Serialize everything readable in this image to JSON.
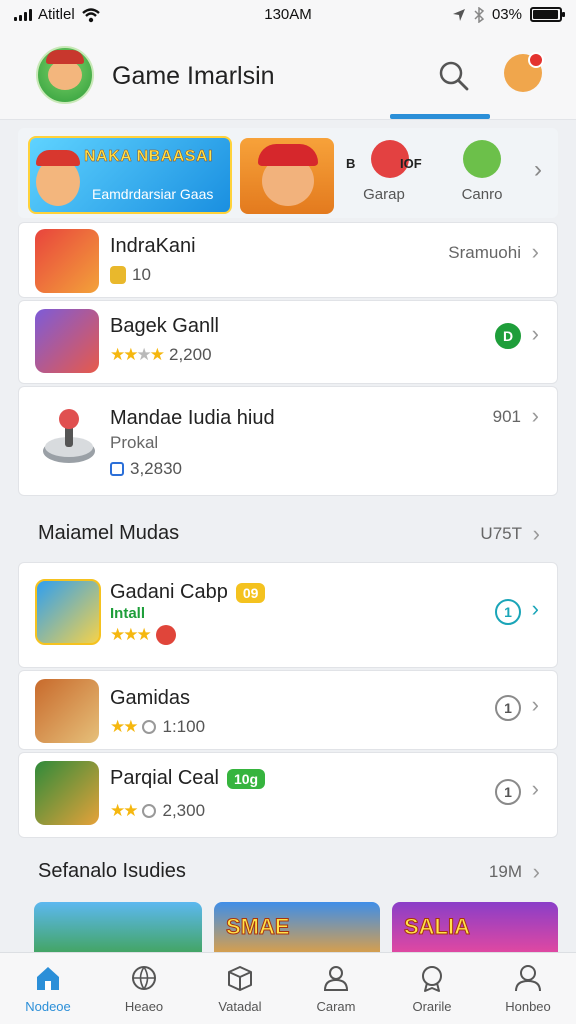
{
  "status_bar": {
    "carrier": "Atitlel",
    "time": "130AM",
    "battery": "03%",
    "battery_level": 0.95
  },
  "header": {
    "app_title": "Game Imarlsin",
    "search_icon": "search-icon",
    "profile_icon": "avatar"
  },
  "carousel": {
    "banner_title": "NAKA NBAASAI",
    "banner_subtitle": "Eamdrdarsiar Gaas",
    "item1_top": "B",
    "item1_top_text": "IOF",
    "item1_label": "Garap",
    "item2_label": "Canro"
  },
  "list": [
    {
      "name": "IndraKani",
      "meta": "10",
      "right": "Sramuohi",
      "accent": "#e9b82c"
    },
    {
      "name": "Bagek Ganll",
      "meta": "2,200",
      "rating": 3,
      "badge": "D",
      "badge_color": "#1e9e3a"
    },
    {
      "name": "Mandae Iudia hiud",
      "sub": "Prokal",
      "meta": "3,2830",
      "right": "901"
    }
  ],
  "section1": {
    "title": "Maiamel Mudas",
    "right": "U75T"
  },
  "section1_items": [
    {
      "name": "Gadani Cabp",
      "badge": "09",
      "badge_color": "#f4c21f",
      "sub": "Intall",
      "rating": 3,
      "info": "1"
    },
    {
      "name": "Gamidas",
      "meta": "1:100",
      "rating": 2,
      "info": "1"
    },
    {
      "name": "Parqial Ceal",
      "badge": "10g",
      "badge_color": "#36b43e",
      "meta": "2,300",
      "rating": 2,
      "info": "1"
    }
  ],
  "section2": {
    "title": "Sefanalo Isudies",
    "right": "19M"
  },
  "promos": [
    {
      "text": ""
    },
    {
      "text": "SMAE"
    },
    {
      "text": "SALIA"
    }
  ],
  "bottom_nav": [
    {
      "label": "Nodeoe",
      "icon": "home-icon",
      "active": true
    },
    {
      "label": "Heaeo",
      "icon": "globe-icon"
    },
    {
      "label": "Vatadal",
      "icon": "box-icon"
    },
    {
      "label": "Caram",
      "icon": "user-icon"
    },
    {
      "label": "Orarile",
      "icon": "award-icon"
    },
    {
      "label": "Honbeo",
      "icon": "profile-icon"
    }
  ],
  "colors": {
    "accent": "#2b8fd8",
    "star": "#f5b70f"
  }
}
